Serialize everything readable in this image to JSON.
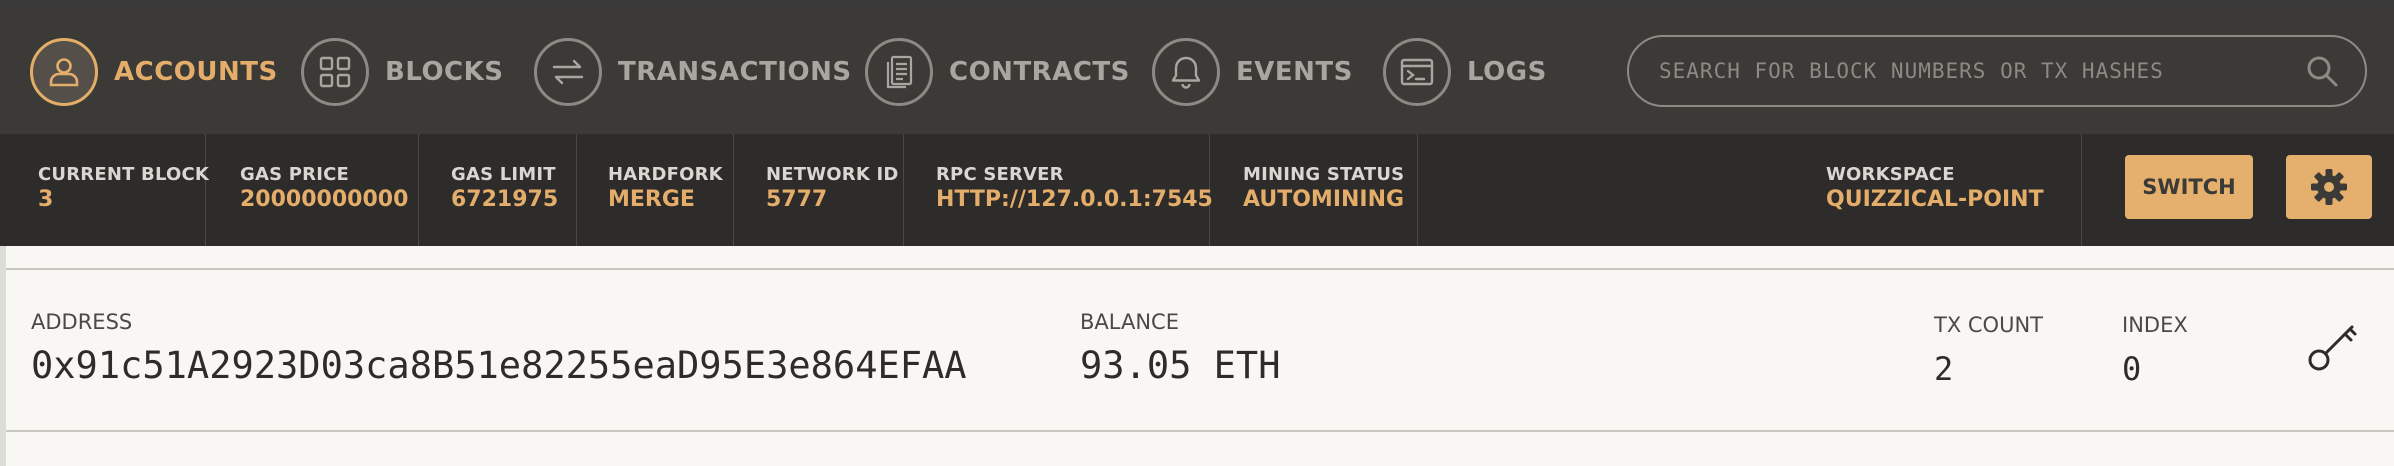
{
  "nav": {
    "items": [
      {
        "label": "ACCOUNTS",
        "icon": "user-icon",
        "active": true
      },
      {
        "label": "BLOCKS",
        "icon": "grid-icon"
      },
      {
        "label": "TRANSACTIONS",
        "icon": "swap-arrows-icon"
      },
      {
        "label": "CONTRACTS",
        "icon": "document-icon"
      },
      {
        "label": "EVENTS",
        "icon": "bell-icon"
      },
      {
        "label": "LOGS",
        "icon": "terminal-icon"
      }
    ],
    "search_placeholder": "SEARCH FOR BLOCK NUMBERS OR TX HASHES"
  },
  "stats": {
    "current_block": {
      "label": "CURRENT BLOCK",
      "value": "3"
    },
    "gas_price": {
      "label": "GAS PRICE",
      "value": "20000000000"
    },
    "gas_limit": {
      "label": "GAS LIMIT",
      "value": "6721975"
    },
    "hardfork": {
      "label": "HARDFORK",
      "value": "MERGE"
    },
    "network_id": {
      "label": "NETWORK ID",
      "value": "5777"
    },
    "rpc_server": {
      "label": "RPC SERVER",
      "value": "HTTP://127.0.0.1:7545"
    },
    "mining_status": {
      "label": "MINING STATUS",
      "value": "AUTOMINING"
    },
    "workspace": {
      "label": "WORKSPACE",
      "value": "QUIZZICAL-POINT"
    }
  },
  "buttons": {
    "switch": "SWITCH"
  },
  "account": {
    "address_label": "ADDRESS",
    "address": "0x91c51A2923D03ca8B51e82255eaD95E3e864EFAA",
    "balance_label": "BALANCE",
    "balance": "93.05 ETH",
    "tx_count_label": "TX COUNT",
    "tx_count": "2",
    "index_label": "INDEX",
    "index": "0"
  },
  "colors": {
    "accent": "#e4ad6a",
    "nav_bg": "#3b3a37",
    "stats_bg": "#2d2c2a",
    "page_bg": "#f8f7f3"
  }
}
